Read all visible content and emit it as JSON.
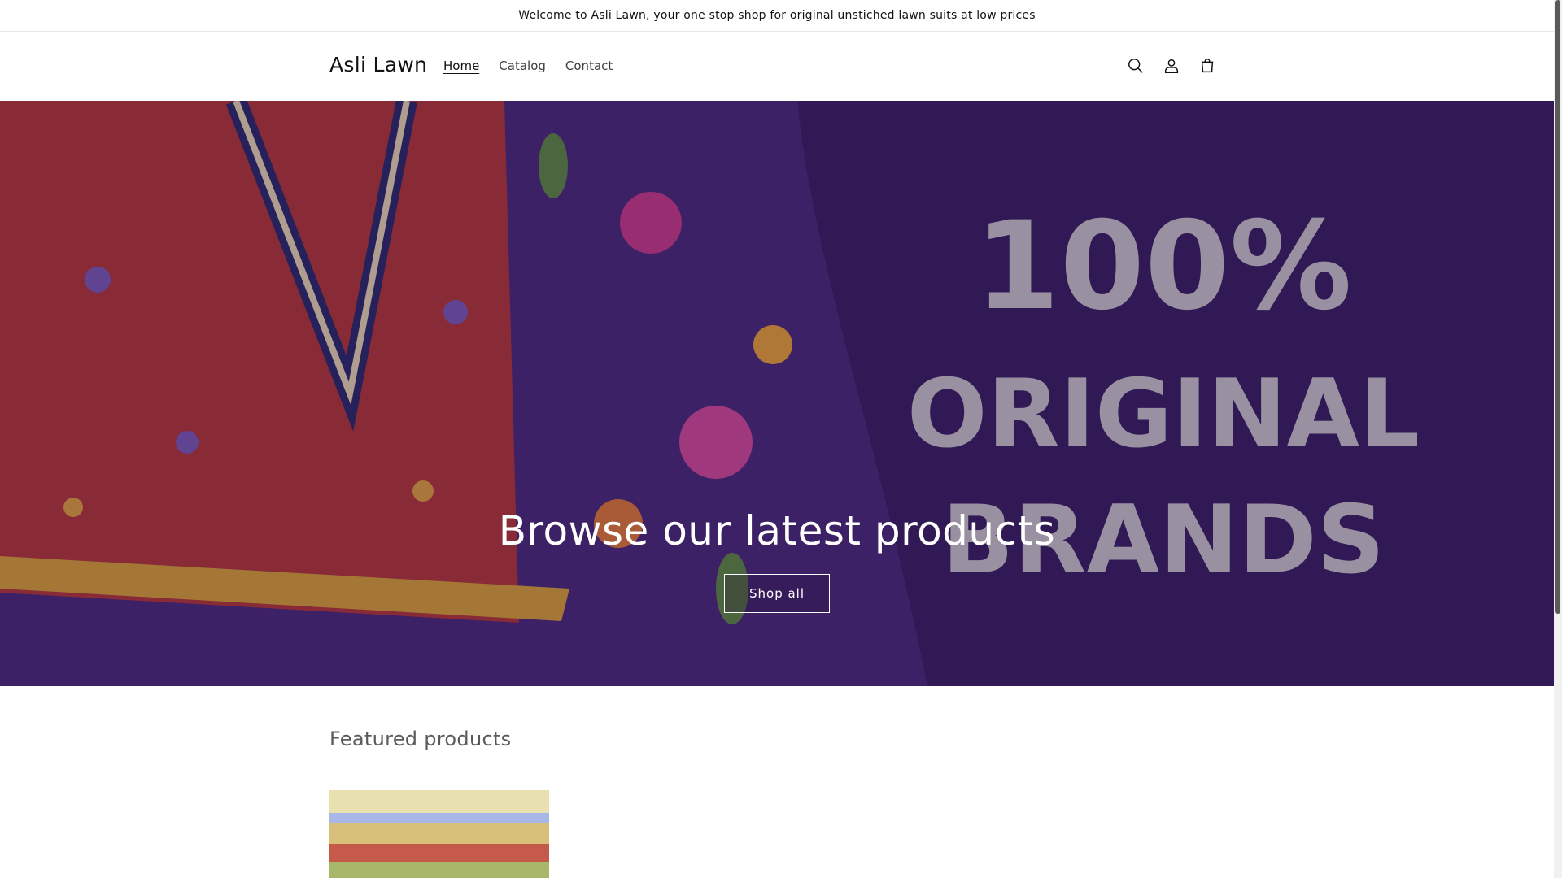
{
  "announcement": {
    "text": "Welcome to Asli Lawn, your one stop shop for original unstiched lawn suits at low prices"
  },
  "header": {
    "logo": "Asli Lawn",
    "nav": [
      {
        "label": "Home",
        "active": true
      },
      {
        "label": "Catalog",
        "active": false
      },
      {
        "label": "Contact",
        "active": false
      }
    ],
    "icons": [
      "search-icon",
      "account-icon",
      "cart-icon"
    ]
  },
  "hero": {
    "heading": "Browse our latest products",
    "button_label": "Shop all",
    "banner_text": [
      "100%",
      "ORIGINAL",
      "BRANDS"
    ],
    "colors": {
      "background": "#3a1f63",
      "fabric_red": "#b3373a",
      "border_gold": "#d9a13a",
      "banner_text": "#c9c4cc"
    }
  },
  "featured": {
    "title": "Featured products"
  }
}
